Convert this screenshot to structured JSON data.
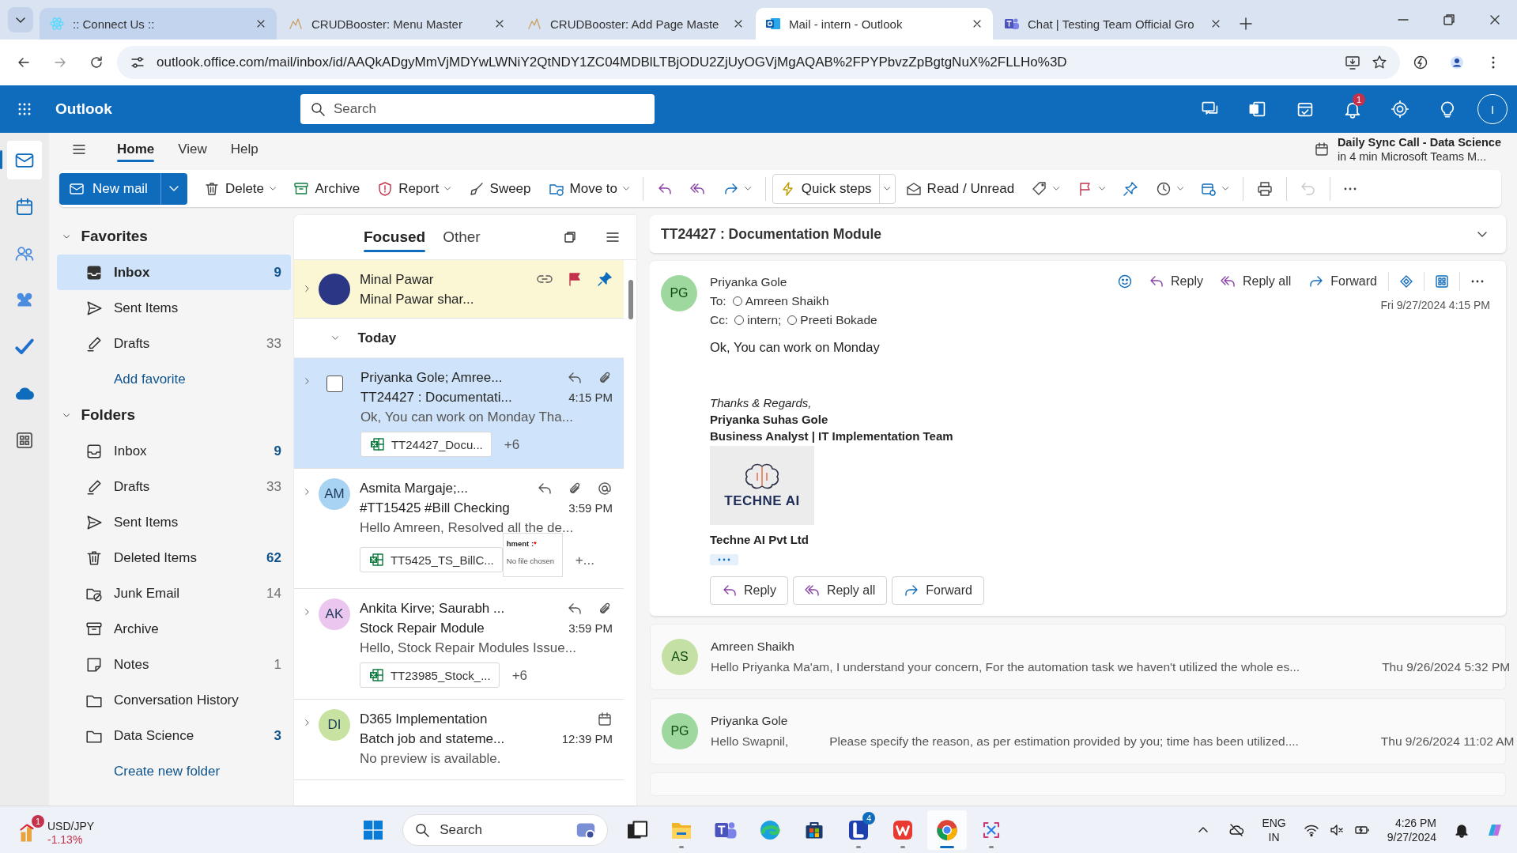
{
  "browser": {
    "tabs": [
      {
        "title": ":: Connect Us ::",
        "selected": false
      },
      {
        "title": "CRUDBooster: Menu Master",
        "selected": false
      },
      {
        "title": "CRUDBooster: Add Page Maste",
        "selected": false
      },
      {
        "title": "Mail - intern - Outlook",
        "selected": true
      },
      {
        "title": "Chat | Testing Team Official Gro",
        "selected": false
      }
    ],
    "url": "outlook.office.com/mail/inbox/id/AAQkADgyMmVjMDYwLWNiY2QtNDY1ZC04MDBlLTBjODU2ZjUyOGVjMgAQAB%2FPYPbvzZpBgtgNuX%2FLLHo%3D"
  },
  "header": {
    "app_name": "Outlook",
    "search_placeholder": "Search",
    "notification_count": "1",
    "avatar_initial": "I"
  },
  "rail": [
    {
      "selected": true
    },
    {
      "selected": false
    },
    {
      "selected": false
    },
    {
      "selected": false
    },
    {
      "selected": false
    },
    {
      "selected": false
    },
    {
      "selected": false
    }
  ],
  "ribbon_tabs": [
    {
      "label": "Home",
      "selected": true
    },
    {
      "label": "View",
      "selected": false
    },
    {
      "label": "Help",
      "selected": false
    }
  ],
  "reminder": {
    "title": "Daily Sync Call - Data Science",
    "detail": "in 4 min Microsoft Teams M..."
  },
  "toolbar": [
    [
      {
        "label": "New mail",
        "kind": "primary",
        "dropdown": true,
        "disabled": false
      }
    ],
    [
      {
        "label": "Delete",
        "kind": "plain",
        "dropdown": true,
        "disabled": false
      },
      {
        "label": "Archive",
        "kind": "plain",
        "dropdown": false,
        "disabled": false
      },
      {
        "label": "Report",
        "kind": "plain",
        "dropdown": true,
        "disabled": false
      },
      {
        "label": "Sweep",
        "kind": "plain",
        "dropdown": false,
        "disabled": false
      },
      {
        "label": "Move to",
        "kind": "plain",
        "dropdown": true,
        "disabled": false
      }
    ],
    [
      {
        "kind": "plain",
        "dropdown": false,
        "disabled": false
      },
      {
        "kind": "plain",
        "dropdown": false,
        "disabled": false
      },
      {
        "kind": "plain",
        "dropdown": true,
        "disabled": false
      }
    ],
    [
      {
        "label": "Quick steps",
        "kind": "split",
        "dropdown": true,
        "disabled": false
      },
      {
        "label": "Read / Unread",
        "kind": "plain",
        "dropdown": false,
        "disabled": false
      },
      {
        "kind": "plain",
        "dropdown": true,
        "disabled": false
      },
      {
        "kind": "plain",
        "dropdown": true,
        "disabled": false
      },
      {
        "kind": "plain",
        "dropdown": false,
        "disabled": false
      },
      {
        "kind": "plain",
        "dropdown": true,
        "disabled": false
      },
      {
        "kind": "plain",
        "dropdown": true,
        "disabled": false
      }
    ],
    [
      {
        "kind": "plain",
        "dropdown": false,
        "disabled": false
      }
    ],
    [
      {
        "kind": "plain",
        "dropdown": false,
        "disabled": true
      }
    ],
    [
      {
        "kind": "plain",
        "dropdown": false,
        "disabled": false
      }
    ]
  ],
  "folder_pane": {
    "sections": [
      {
        "title": "Favorites",
        "expanded": true,
        "items": [
          {
            "name": "Inbox",
            "count": "9",
            "unread": true,
            "selected": true
          },
          {
            "name": "Sent Items",
            "selected": false
          },
          {
            "name": "Drafts",
            "count": "33",
            "unread": false,
            "selected": false
          }
        ],
        "link": "Add favorite"
      },
      {
        "title": "Folders",
        "expanded": true,
        "items": [
          {
            "name": "Inbox",
            "count": "9",
            "unread": true,
            "selected": false
          },
          {
            "name": "Drafts",
            "count": "33",
            "unread": false,
            "selected": false
          },
          {
            "name": "Sent Items",
            "selected": false
          },
          {
            "name": "Deleted Items",
            "count": "62",
            "unread": true,
            "selected": false
          },
          {
            "name": "Junk Email",
            "count": "14",
            "unread": false,
            "selected": false
          },
          {
            "name": "Archive",
            "selected": false
          },
          {
            "name": "Notes",
            "count": "1",
            "unread": false,
            "selected": false
          },
          {
            "name": "Conversation History",
            "selected": false
          },
          {
            "name": "Data Science",
            "count": "3",
            "unread": true,
            "selected": false
          }
        ],
        "link": "Create new folder"
      }
    ]
  },
  "message_list": {
    "tabs": [
      {
        "label": "Focused",
        "selected": true
      },
      {
        "label": "Other",
        "selected": false
      }
    ],
    "pinned": [
      {
        "sender": "Minal Pawar",
        "subject": "Minal Pawar shar...",
        "color": "#2b3784",
        "link": true,
        "flagged": true,
        "pinned": true
      }
    ],
    "group": {
      "title": "Today",
      "expanded": true
    },
    "messages": [
      {
        "sender": "Priyanka Gole; Amree...",
        "subject": "TT24427 : Documentati...",
        "time": "4:15 PM",
        "preview": "Ok, You can work on Monday Tha...",
        "selected": true,
        "replied": true,
        "attachment": true,
        "mention": false,
        "meeting": false,
        "files": [
          {
            "name": "TT24427_Docu...",
            "kind": "excel"
          }
        ],
        "more": "+6"
      },
      {
        "sender": "Asmita Margaje;...",
        "initials": "AM",
        "color": "#a9d3f2",
        "subject": "#TT15425 #Bill Checking",
        "time": "3:59 PM",
        "preview": "Hello Amreen, Resolved all the de...",
        "selected": false,
        "replied": true,
        "attachment": true,
        "mention": true,
        "meeting": false,
        "files": [
          {
            "name": "TT5425_TS_BillC...",
            "kind": "excel"
          },
          {
            "kind": "screenshot",
            "label": "hment :",
            "required": "*",
            "field": "No file chosen"
          }
        ],
        "more": "+..."
      },
      {
        "sender": "Ankita Kirve; Saurabh ...",
        "initials": "AK",
        "color": "#ebc6ef",
        "subject": "Stock Repair Module",
        "time": "3:59 PM",
        "preview": "Hello, Stock Repair Modules Issue...",
        "selected": false,
        "replied": true,
        "attachment": true,
        "mention": false,
        "meeting": false,
        "files": [
          {
            "name": "TT23985_Stock_...",
            "kind": "excel"
          }
        ],
        "more": "+6"
      },
      {
        "sender": "D365 Implementation",
        "initials": "DI",
        "color": "#c8e2a2",
        "subject": "Batch job and stateme...",
        "time": "12:39 PM",
        "preview": "No preview is available.",
        "selected": false,
        "replied": false,
        "attachment": false,
        "mention": false,
        "meeting": true
      }
    ]
  },
  "reading_pane": {
    "subject": "TT24427 : Documentation Module",
    "expanded": true,
    "message": {
      "sender": "Priyanka Gole",
      "initials": "PG",
      "color": "#9fd89f",
      "to_label": "To:",
      "to": [
        "Amreen Shaikh"
      ],
      "cc_label": "Cc:",
      "cc": [
        "intern;",
        "Preeti Bokade"
      ],
      "date": "Fri 9/27/2024 4:15 PM",
      "actions": [
        "Reply",
        "Reply all",
        "Forward"
      ],
      "body": "Ok, You can work on Monday",
      "signature": {
        "closing": "Thanks & Regards,",
        "name": "Priyanka Suhas Gole",
        "role": "Business Analyst | IT Implementation Team",
        "logo_text": "TECHNE AI",
        "company": "Techne AI Pvt Ltd"
      },
      "footer_actions": [
        "Reply",
        "Reply all",
        "Forward"
      ]
    },
    "earlier": [
      {
        "sender": "Amreen Shaikh",
        "initials": "AS",
        "color": "#c5e0a5",
        "preview": [
          "Hello Priyanka Ma'am, I understand your concern, For the automation task we haven't utilized the whole es..."
        ],
        "date": "Thu 9/26/2024 5:32 PM"
      },
      {
        "sender": "Priyanka Gole",
        "initials": "PG",
        "color": "#9fd89f",
        "preview": [
          "Hello Swapnil,",
          "Please specify the reason, as per estimation provided by you; time has been utilized...."
        ],
        "date": "Thu 9/26/2024 11:02 AM"
      }
    ]
  },
  "taskbar": {
    "widget": {
      "title": "USD/JPY",
      "change": "-1.13%",
      "badge": "1"
    },
    "search_placeholder": "Search",
    "apps": [
      {
        "running": false,
        "active": false
      },
      {
        "running": true,
        "active": false
      },
      {
        "running": false,
        "active": false
      },
      {
        "running": false,
        "active": false
      },
      {
        "running": false,
        "active": false
      },
      {
        "running": true,
        "active": false,
        "badge": "4"
      },
      {
        "running": true,
        "active": false
      },
      {
        "running": true,
        "active": true
      },
      {
        "running": true,
        "active": false
      }
    ],
    "language": "ENG",
    "region": "IN",
    "time": "4:26 PM",
    "date": "9/27/2024"
  }
}
